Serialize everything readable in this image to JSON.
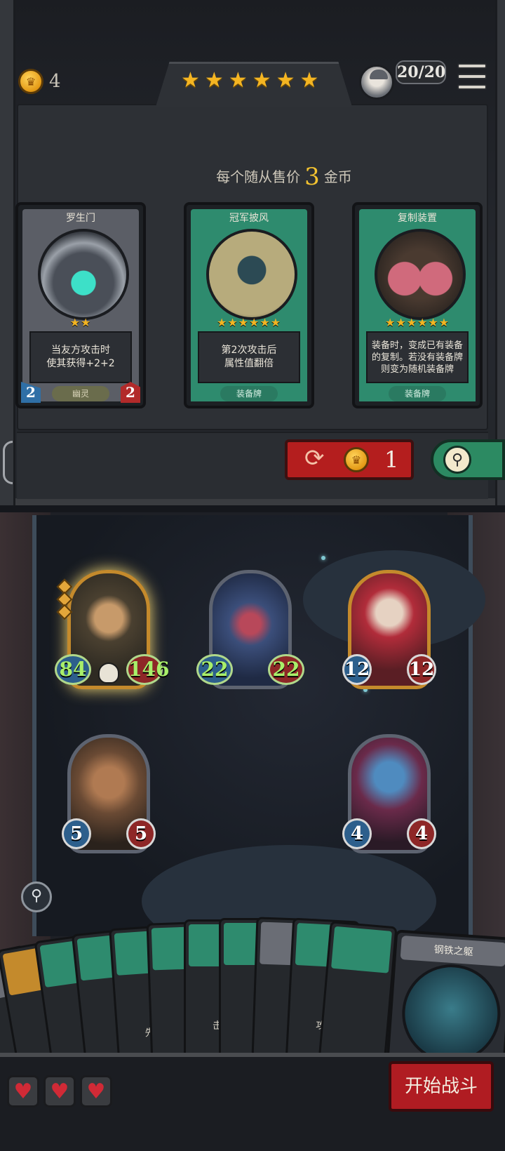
{
  "hud": {
    "gold": "4",
    "tavern_stars": [
      "★",
      "★",
      "★",
      "★",
      "★",
      "★"
    ],
    "board_count": "20/20"
  },
  "shop": {
    "price_prefix": "每个随从售价",
    "price_value": "3",
    "price_suffix": "金币",
    "cards": [
      {
        "name": "罗生门",
        "stars": "★★",
        "text_line1": "当友方攻击时",
        "text_line2": "使其获得+2+2",
        "tag": "幽灵",
        "attack": "2",
        "health": "2",
        "frame_color": "#5b5e66"
      },
      {
        "name": "冠军披风",
        "stars": "★★★★★★",
        "text_line1": "第2次攻击后",
        "text_line2": "属性值翻倍",
        "tag": "装备牌",
        "frame_color": "#2e8b6e"
      },
      {
        "name": "复制装置",
        "stars": "★★★★★★",
        "text_line1": "装备时，变成已有装备",
        "text_line2": "的复制。若没有装备牌",
        "text_line3": "则变为随机装备牌",
        "tag": "装备牌",
        "frame_color": "#2e8b6e"
      }
    ],
    "refresh_cost": "1"
  },
  "board": {
    "minions": [
      {
        "attack": "84",
        "health": "146"
      },
      {
        "attack": "22",
        "health": "22"
      },
      {
        "attack": "12",
        "health": "12"
      },
      {
        "attack": "5",
        "health": "5"
      },
      {
        "attack": "4",
        "health": "4"
      }
    ]
  },
  "hand": {
    "labels": [
      "先",
      "击",
      "攻"
    ],
    "featured_card_name": "钢铁之躯"
  },
  "footer": {
    "lives": [
      "♥",
      "♥",
      "♥"
    ],
    "start_button": "开始战斗"
  },
  "colors": {
    "accent_gold": "#f4b522",
    "danger_red": "#b41e1e",
    "equip_green": "#2e8b6e"
  }
}
